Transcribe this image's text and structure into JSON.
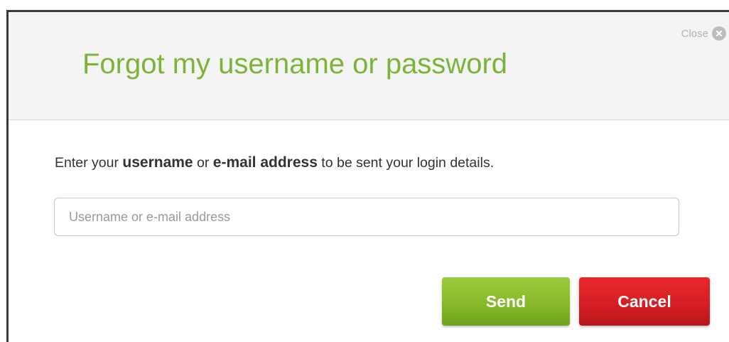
{
  "dialog": {
    "title": "Forgot my username or password",
    "close_label": "Close",
    "close_icon": "close-circle-icon"
  },
  "instructions": {
    "part1": "Enter your ",
    "bold1": "username",
    "part2": " or ",
    "bold2": "e-mail address",
    "part3": " to be sent your login details."
  },
  "input": {
    "value": "",
    "placeholder": "Username or e-mail address"
  },
  "buttons": {
    "send_label": "Send",
    "cancel_label": "Cancel"
  },
  "colors": {
    "title": "#7cb43a",
    "send": "#86b92b",
    "cancel": "#d41f24",
    "header_bg": "#f4f4f4"
  }
}
